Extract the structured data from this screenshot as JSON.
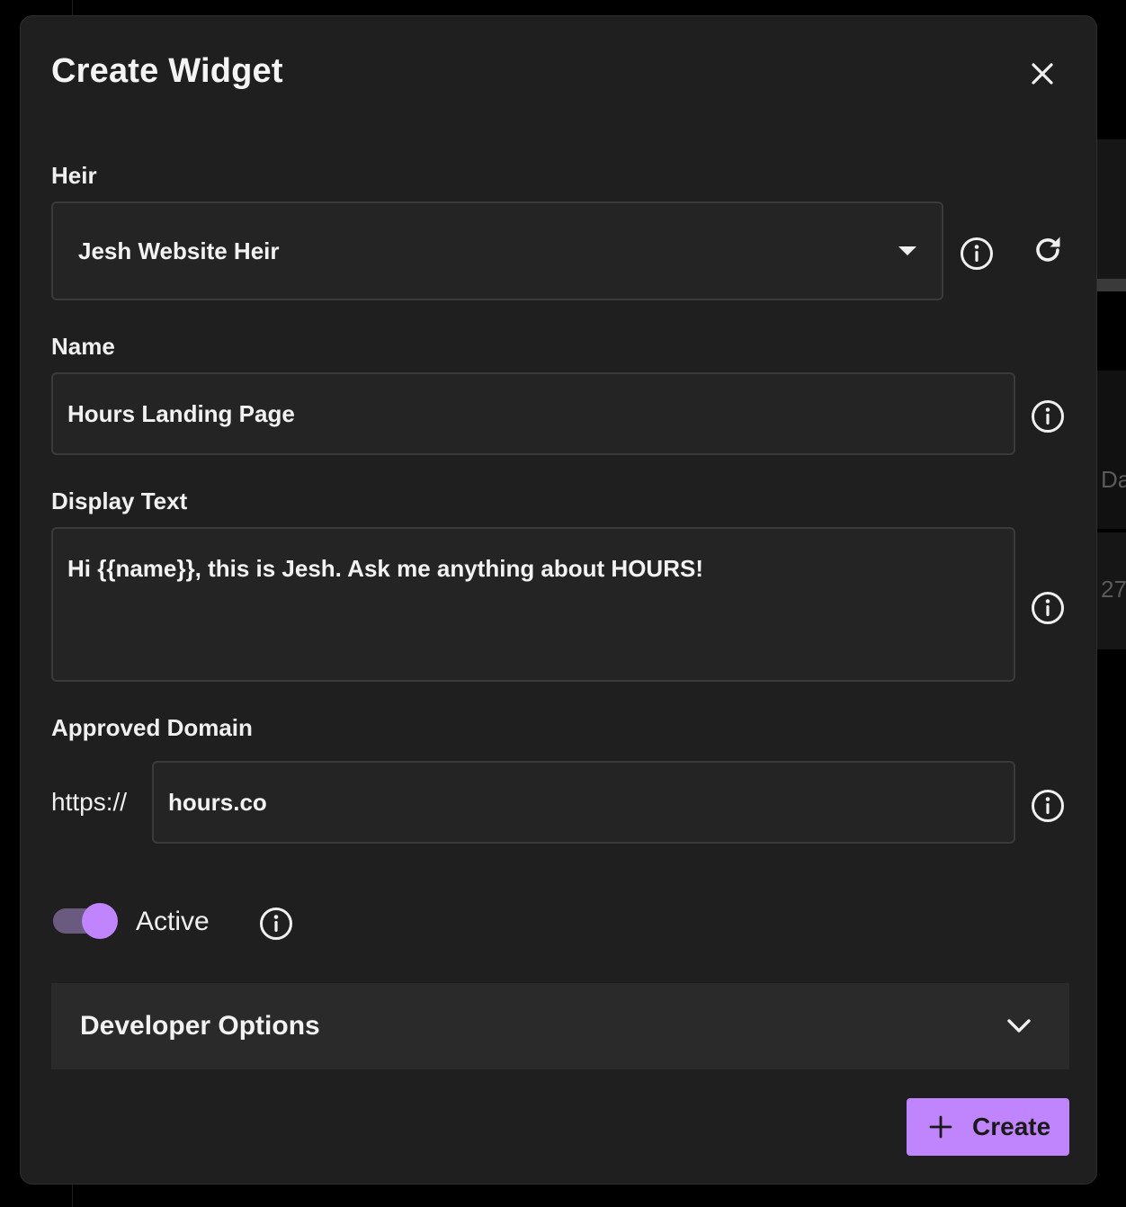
{
  "background": {
    "partial_text_1": "Da",
    "partial_text_2": "27"
  },
  "modal": {
    "title": "Create Widget",
    "heir": {
      "label": "Heir",
      "value": "Jesh Website Heir"
    },
    "name": {
      "label": "Name",
      "value": "Hours Landing Page"
    },
    "display_text": {
      "label": "Display Text",
      "value": "Hi {{name}}, this is Jesh. Ask me anything about HOURS!"
    },
    "approved_domain": {
      "label": "Approved Domain",
      "prefix": "https://",
      "value": "hours.co"
    },
    "active": {
      "label": "Active",
      "checked": true
    },
    "developer_options": {
      "label": "Developer Options",
      "expanded": false
    },
    "create_button": {
      "label": "Create"
    }
  },
  "icons": {
    "close": "close-icon",
    "dropdown": "caret-down-icon",
    "info": "info-icon",
    "refresh": "refresh-icon",
    "chevron": "chevron-down-icon",
    "plus": "plus-icon"
  },
  "colors": {
    "accent": "#c084fc",
    "toggle_track": "#6b5a80",
    "modal_bg": "#1f1f1f",
    "field_bg": "#242424",
    "field_border": "#3a3a3a",
    "section_bg": "#2a2a2a"
  }
}
